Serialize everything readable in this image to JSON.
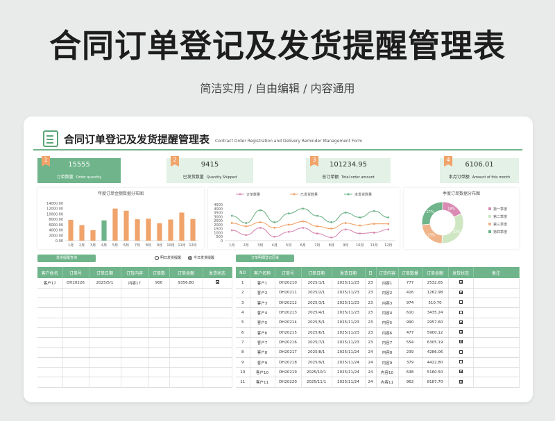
{
  "hero": {
    "title": "合同订单登记及发货提醒管理表",
    "subtitle": "简洁实用 / 自由编辑 / 内容通用"
  },
  "sheet": {
    "title": "合同订单登记及发货提醒管理表",
    "title_en": "Contract Order Registration and Delivery Reminder Management Form"
  },
  "kpis": [
    {
      "num": "1",
      "value": "15555",
      "label": "订单数量",
      "label_en": "Order quantity"
    },
    {
      "num": "2",
      "value": "9415",
      "label": "已发货数量",
      "label_en": "Quantity Shipped"
    },
    {
      "num": "3",
      "value": "101234.95",
      "label": "总订单额",
      "label_en": "Total order amount"
    },
    {
      "num": "4",
      "value": "6106.01",
      "label": "本月订单额",
      "label_en": "Amount of this month"
    }
  ],
  "colors": {
    "green": "#6fb48a",
    "orange": "#f0a36a",
    "pink": "#d98bb3",
    "light_green": "#cfe6c2",
    "bar_dark": "#6fb48a"
  },
  "chart_data": [
    {
      "type": "bar",
      "title": "年度订单金额数据分布图",
      "categories": [
        "1月",
        "2月",
        "3月",
        "4月",
        "5月",
        "6月",
        "7月",
        "8月",
        "9月",
        "10月",
        "11月",
        "12月"
      ],
      "values": [
        7800,
        5800,
        3900,
        7600,
        12000,
        11200,
        8000,
        8200,
        6500,
        7900,
        10500,
        8100
      ],
      "highlight_index": [
        3,
        4
      ],
      "yticks": [
        "14000.00",
        "12000.00",
        "10000.00",
        "8000.00",
        "6000.00",
        "4000.00",
        "2000.00",
        "0.00"
      ],
      "ylim": [
        0,
        14000
      ]
    },
    {
      "type": "line",
      "legend": [
        "订单数量",
        "已发货数量",
        "未发货数量"
      ],
      "categories": [
        "1月",
        "2月",
        "3月",
        "4月",
        "5月",
        "6月",
        "7月",
        "8月",
        "9月",
        "10月",
        "11月",
        "12月"
      ],
      "series": [
        {
          "name": "订单数量",
          "values": [
            1300,
            700,
            1600,
            500,
            1100,
            1600,
            900,
            400,
            1400,
            900,
            1000,
            1400
          ]
        },
        {
          "name": "已发货数量",
          "values": [
            2200,
            1800,
            2300,
            1600,
            2000,
            2400,
            1800,
            1500,
            2200,
            1900,
            2100,
            2100
          ]
        },
        {
          "name": "未发货数量",
          "values": [
            3100,
            2200,
            3800,
            2300,
            3400,
            4000,
            3100,
            2300,
            3500,
            2900,
            3700,
            2900
          ]
        }
      ],
      "yticks": [
        "4500",
        "4000",
        "3500",
        "3000",
        "2500",
        "2000",
        "1500",
        "1000",
        "500",
        "0"
      ],
      "ylim": [
        0,
        4500
      ]
    },
    {
      "type": "pie",
      "title": "季度订单数据分布图",
      "labels": [
        "第一季度",
        "第二季度",
        "第三季度",
        "第四季度"
      ],
      "values": [
        18,
        33,
        23,
        27
      ],
      "slice_labels": [
        "18%",
        "33%",
        "23%",
        "27%"
      ]
    }
  ],
  "left_panel": {
    "pill": "发货提醒查询",
    "radios": [
      "明日发货提醒",
      "今日发货提醒"
    ],
    "columns": [
      "客户姓名",
      "订单号",
      "订单日期",
      "订货内容",
      "订单数",
      "订单金额",
      "发货状态"
    ],
    "rows": [
      [
        "客户17",
        "DH20226",
        "2025/5/1",
        "内容17",
        "900",
        "9356.80",
        "checked"
      ]
    ]
  },
  "right_panel": {
    "pill": "订单明细登记区域",
    "columns": [
      "NO",
      "客户名称",
      "订单号",
      "订单日期",
      "发货日期",
      "日",
      "订货内容",
      "订单数量",
      "订单金额",
      "发货状态",
      "备注"
    ],
    "rows": [
      [
        "1",
        "客户1",
        "DH20210",
        "2025/1/1",
        "2025/11/23",
        "23",
        "内容1",
        "777",
        "2532.65",
        "checked",
        ""
      ],
      [
        "2",
        "客户2",
        "DH20211",
        "2025/2/1",
        "2025/11/23",
        "23",
        "内容2",
        "416",
        "1262.98",
        "checked",
        ""
      ],
      [
        "3",
        "客户3",
        "DH20212",
        "2025/3/1",
        "2025/11/23",
        "23",
        "内容3",
        "974",
        "510.70",
        "unchecked",
        ""
      ],
      [
        "4",
        "客户4",
        "DH20213",
        "2025/4/1",
        "2025/11/23",
        "23",
        "内容4",
        "610",
        "3435.24",
        "unchecked",
        ""
      ],
      [
        "5",
        "客户5",
        "DH20214",
        "2025/5/1",
        "2025/11/23",
        "23",
        "内容5",
        "990",
        "2957.60",
        "checked",
        ""
      ],
      [
        "6",
        "客户6",
        "DH20215",
        "2025/6/1",
        "2025/11/23",
        "23",
        "内容6",
        "477",
        "5900.12",
        "checked",
        ""
      ],
      [
        "7",
        "客户7",
        "DH20216",
        "2025/7/1",
        "2025/11/23",
        "23",
        "内容7",
        "554",
        "6305.19",
        "checked",
        ""
      ],
      [
        "8",
        "客户8",
        "DH20217",
        "2025/8/1",
        "2025/11/24",
        "24",
        "内容8",
        "239",
        "4286.06",
        "unchecked",
        ""
      ],
      [
        "9",
        "客户9",
        "DH20218",
        "2025/9/1",
        "2025/11/24",
        "24",
        "内容9",
        "379",
        "4422.80",
        "unchecked",
        ""
      ],
      [
        "10",
        "客户10",
        "DH20219",
        "2025/10/1",
        "2025/11/24",
        "24",
        "内容10",
        "638",
        "5160.50",
        "checked",
        ""
      ],
      [
        "11",
        "客户11",
        "DH20220",
        "2025/11/1",
        "2025/11/24",
        "24",
        "内容11",
        "962",
        "8187.70",
        "checked",
        ""
      ]
    ]
  }
}
